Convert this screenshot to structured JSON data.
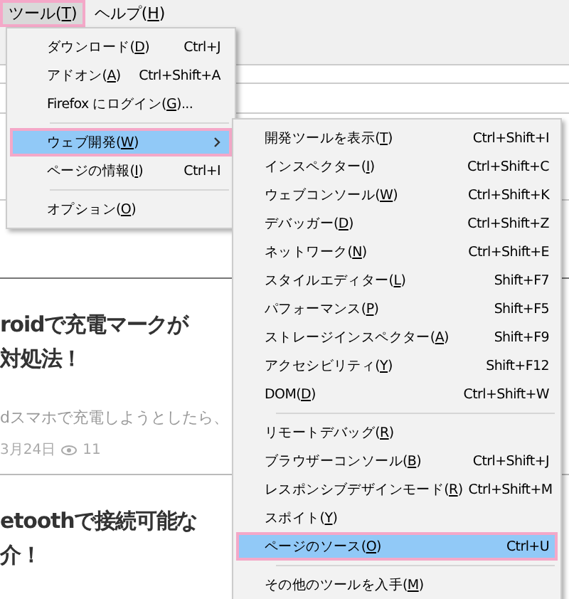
{
  "menu_bar": [
    {
      "label": "ツール(",
      "key": "T",
      "tail": ")",
      "selected": true
    },
    {
      "label": "ヘルプ(",
      "key": "H",
      "tail": ")",
      "selected": false
    }
  ],
  "tools_menu": [
    {
      "kind": "item",
      "label": "ダウンロード(",
      "key": "D",
      "tail": ")",
      "shortcut": "Ctrl+J",
      "selected": false
    },
    {
      "kind": "item",
      "label": "アドオン(",
      "key": "A",
      "tail": ")",
      "shortcut": "Ctrl+Shift+A",
      "selected": false
    },
    {
      "kind": "item",
      "label": "Firefox にログイン(",
      "key": "G",
      "tail": ")...",
      "selected": false
    },
    {
      "kind": "separator"
    },
    {
      "kind": "submenu",
      "label": "ウェブ開発(",
      "key": "W",
      "tail": ")",
      "selected": true
    },
    {
      "kind": "item",
      "label": "ページの情報(",
      "key": "I",
      "tail": ")",
      "shortcut": "Ctrl+I",
      "selected": false
    },
    {
      "kind": "separator"
    },
    {
      "kind": "item",
      "label": "オプション(",
      "key": "O",
      "tail": ")",
      "selected": false
    }
  ],
  "web_developer_menu": [
    {
      "kind": "item",
      "label": "開発ツールを表示(",
      "key": "T",
      "tail": ")",
      "shortcut": "Ctrl+Shift+I",
      "selected": false
    },
    {
      "kind": "item",
      "label": "インスペクター(",
      "key": "I",
      "tail": ")",
      "shortcut": "Ctrl+Shift+C",
      "selected": false
    },
    {
      "kind": "item",
      "label": "ウェブコンソール(",
      "key": "W",
      "tail": ")",
      "shortcut": "Ctrl+Shift+K",
      "selected": false
    },
    {
      "kind": "item",
      "label": "デバッガー(",
      "key": "D",
      "tail": ")",
      "shortcut": "Ctrl+Shift+Z",
      "selected": false
    },
    {
      "kind": "item",
      "label": "ネットワーク(",
      "key": "N",
      "tail": ")",
      "shortcut": "Ctrl+Shift+E",
      "selected": false
    },
    {
      "kind": "item",
      "label": "スタイルエディター(",
      "key": "L",
      "tail": ")",
      "shortcut": "Shift+F7",
      "selected": false
    },
    {
      "kind": "item",
      "label": "パフォーマンス(",
      "key": "P",
      "tail": ")",
      "shortcut": "Shift+F5",
      "selected": false
    },
    {
      "kind": "item",
      "label": "ストレージインスペクター(",
      "key": "A",
      "tail": ")",
      "shortcut": "Shift+F9",
      "selected": false
    },
    {
      "kind": "item",
      "label": "アクセシビリティ(",
      "key": "Y",
      "tail": ")",
      "shortcut": "Shift+F12",
      "selected": false
    },
    {
      "kind": "item",
      "label": "DOM(",
      "key": "D",
      "tail": ")",
      "shortcut": "Ctrl+Shift+W",
      "selected": false
    },
    {
      "kind": "separator"
    },
    {
      "kind": "item",
      "label": "リモートデバッグ(",
      "key": "R",
      "tail": ")",
      "selected": false
    },
    {
      "kind": "item",
      "label": "ブラウザーコンソール(",
      "key": "B",
      "tail": ")",
      "shortcut": "Ctrl+Shift+J",
      "selected": false
    },
    {
      "kind": "item",
      "label": "レスポンシブデザインモード(",
      "key": "R",
      "tail": ")",
      "shortcut": "Ctrl+Shift+M",
      "selected": false
    },
    {
      "kind": "item",
      "label": "スポイト(",
      "key": "Y",
      "tail": ")",
      "selected": false
    },
    {
      "kind": "item",
      "label": "ページのソース(",
      "key": "O",
      "tail": ")",
      "shortcut": "Ctrl+U",
      "selected": true
    },
    {
      "kind": "separator"
    },
    {
      "kind": "item",
      "label": "その他のツールを入手(",
      "key": "M",
      "tail": ")",
      "selected": false
    }
  ],
  "articles": [
    {
      "title_lines": [
        "roidで充電マークが",
        "対処法！"
      ],
      "excerpt": "dスマホで充電しようとしたら、",
      "date": "3月24日",
      "views": "11"
    },
    {
      "title_lines": [
        "etoothで接続可能な",
        "介！"
      ]
    }
  ]
}
